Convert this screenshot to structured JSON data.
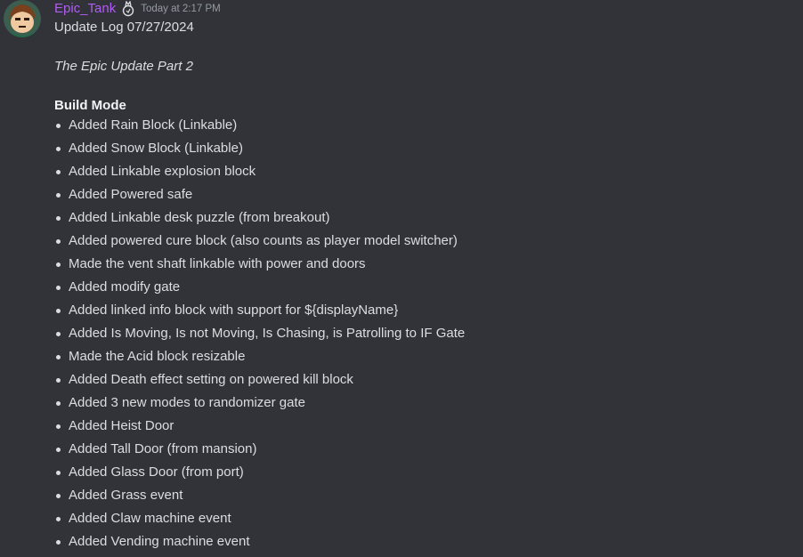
{
  "message": {
    "author": "Epic_Tank",
    "timestamp": "Today at 2:17 PM",
    "avatar_icon": "avatar-icon",
    "role_icon": "role-badge-icon",
    "username_color": "#b05cf2",
    "lines": {
      "title": "Update Log 07/27/2024",
      "subtitle": "The Epic Update Part 2",
      "section": "Build Mode"
    },
    "bullets": [
      "Added Rain Block (Linkable)",
      "Added Snow Block (Linkable)",
      "Added Linkable explosion block",
      "Added Powered safe",
      "Added Linkable desk puzzle (from breakout)",
      "Added powered cure block (also counts as player model switcher)",
      "Made the vent shaft linkable with power and doors",
      "Added modify gate",
      "Added linked info block with support for ${displayName}",
      "Added Is Moving, Is not Moving, Is Chasing, is Patrolling to IF Gate",
      "Made the Acid block resizable",
      "Added Death effect setting on powered kill block",
      "Added 3 new modes to randomizer gate",
      "Added Heist Door",
      "Added Tall Door (from mansion)",
      "Added Glass Door (from port)",
      "Added Grass event",
      "Added Claw machine event",
      "Added Vending machine event"
    ]
  }
}
